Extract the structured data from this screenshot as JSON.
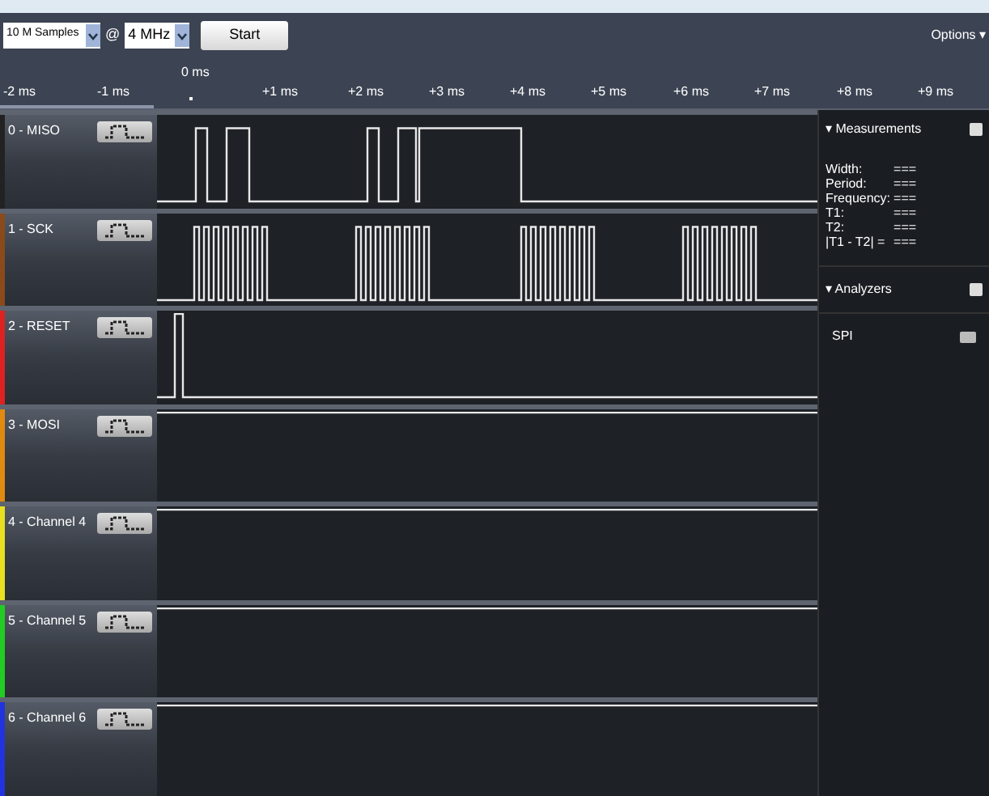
{
  "toolbar": {
    "samples": "10 M Samples",
    "at": "@",
    "rate": "4 MHz",
    "start": "Start",
    "options": "Options ▾"
  },
  "timeline": {
    "cursor": "0 ms",
    "ticks": [
      "-2 ms",
      "-1 ms",
      "+1 ms",
      "+2 ms",
      "+3 ms",
      "+4 ms",
      "+5 ms",
      "+6 ms",
      "+7 ms",
      "+8 ms",
      "+9 ms"
    ]
  },
  "channels": [
    {
      "name": "0 - MISO",
      "color": "#222222"
    },
    {
      "name": "1 - SCK",
      "color": "#8a4a1a"
    },
    {
      "name": "2 - RESET",
      "color": "#dd2222"
    },
    {
      "name": "3 - MOSI",
      "color": "#e08a10"
    },
    {
      "name": "4 - Channel 4",
      "color": "#e8e020"
    },
    {
      "name": "5 - Channel 5",
      "color": "#22cc22"
    },
    {
      "name": "6 - Channel 6",
      "color": "#2233dd"
    }
  ],
  "measurements": {
    "title": "▾ Measurements",
    "rows": [
      {
        "label": "Width:",
        "value": "==="
      },
      {
        "label": "Period:",
        "value": "==="
      },
      {
        "label": "Frequency:",
        "value": "==="
      },
      {
        "label": "T1:",
        "value": "==="
      },
      {
        "label": "T2:",
        "value": "==="
      },
      {
        "label": "|T1 - T2| =",
        "value": "==="
      }
    ]
  },
  "analyzers": {
    "title": "▾ Analyzers",
    "items": [
      "SPI"
    ]
  }
}
